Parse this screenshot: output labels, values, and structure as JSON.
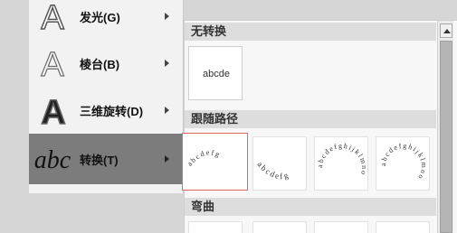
{
  "menu": {
    "items": [
      {
        "label": "发光(G)",
        "icon": "glow-a-icon"
      },
      {
        "label": "棱台(B)",
        "icon": "bevel-a-icon"
      },
      {
        "label": "三维旋转(D)",
        "icon": "3d-rotation-a-icon"
      },
      {
        "label": "转换(T)",
        "icon": "transform-abc-icon",
        "selected": true
      }
    ]
  },
  "gallery": {
    "sections": [
      {
        "title": "无转换"
      },
      {
        "title": "跟随路径"
      },
      {
        "title": "弯曲"
      }
    ],
    "no_transform_label": "abcde",
    "follow_path_tiles": [
      {
        "text": "abcdefg"
      },
      {
        "text": "abcdefg"
      },
      {
        "text": "abcdefghijklmno"
      },
      {
        "text": "abcdefghijklmno"
      }
    ]
  }
}
